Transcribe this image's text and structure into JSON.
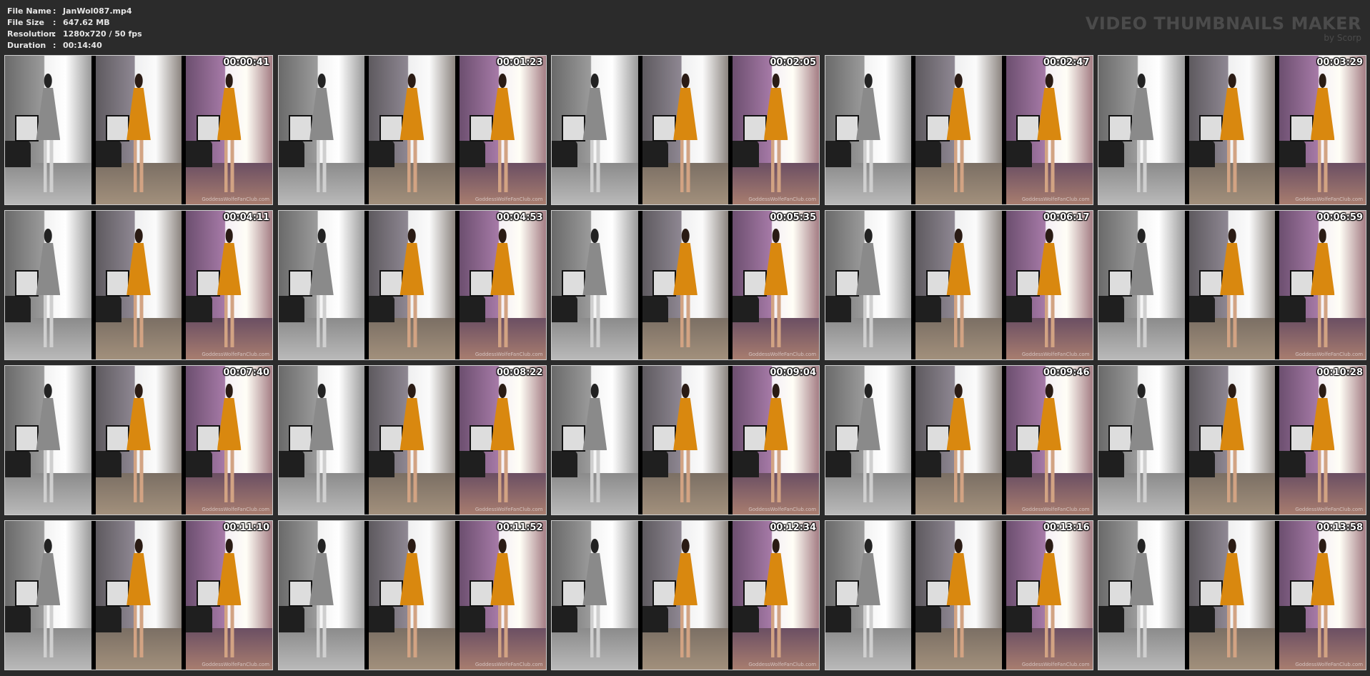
{
  "info": {
    "rows": [
      {
        "label": "File Name",
        "value": "JanWol087.mp4"
      },
      {
        "label": "File Size",
        "value": "647.62 MB"
      },
      {
        "label": "Resolution",
        "value": "1280x720 / 50 fps"
      },
      {
        "label": "Duration",
        "value": "00:14:40"
      }
    ],
    "separator": ":"
  },
  "brand": {
    "title": "VIDEO THUMBNAILS MAKER",
    "subtitle": "by Scorp"
  },
  "watermark": "GoddessWolfeFanClub.com",
  "timestamps": [
    "00:00:41",
    "00:01:23",
    "00:02:05",
    "00:02:47",
    "00:03:29",
    "00:04:11",
    "00:04:53",
    "00:05:35",
    "00:06:17",
    "00:06:59",
    "00:07:40",
    "00:08:22",
    "00:09:04",
    "00:09:46",
    "00:10:28",
    "00:11:10",
    "00:11:52",
    "00:12:34",
    "00:13:16",
    "00:13:58"
  ],
  "colors": {
    "background": "#2b2b2b",
    "brand_text": "#4b4b4b",
    "dress_orange": "#d9880f"
  }
}
